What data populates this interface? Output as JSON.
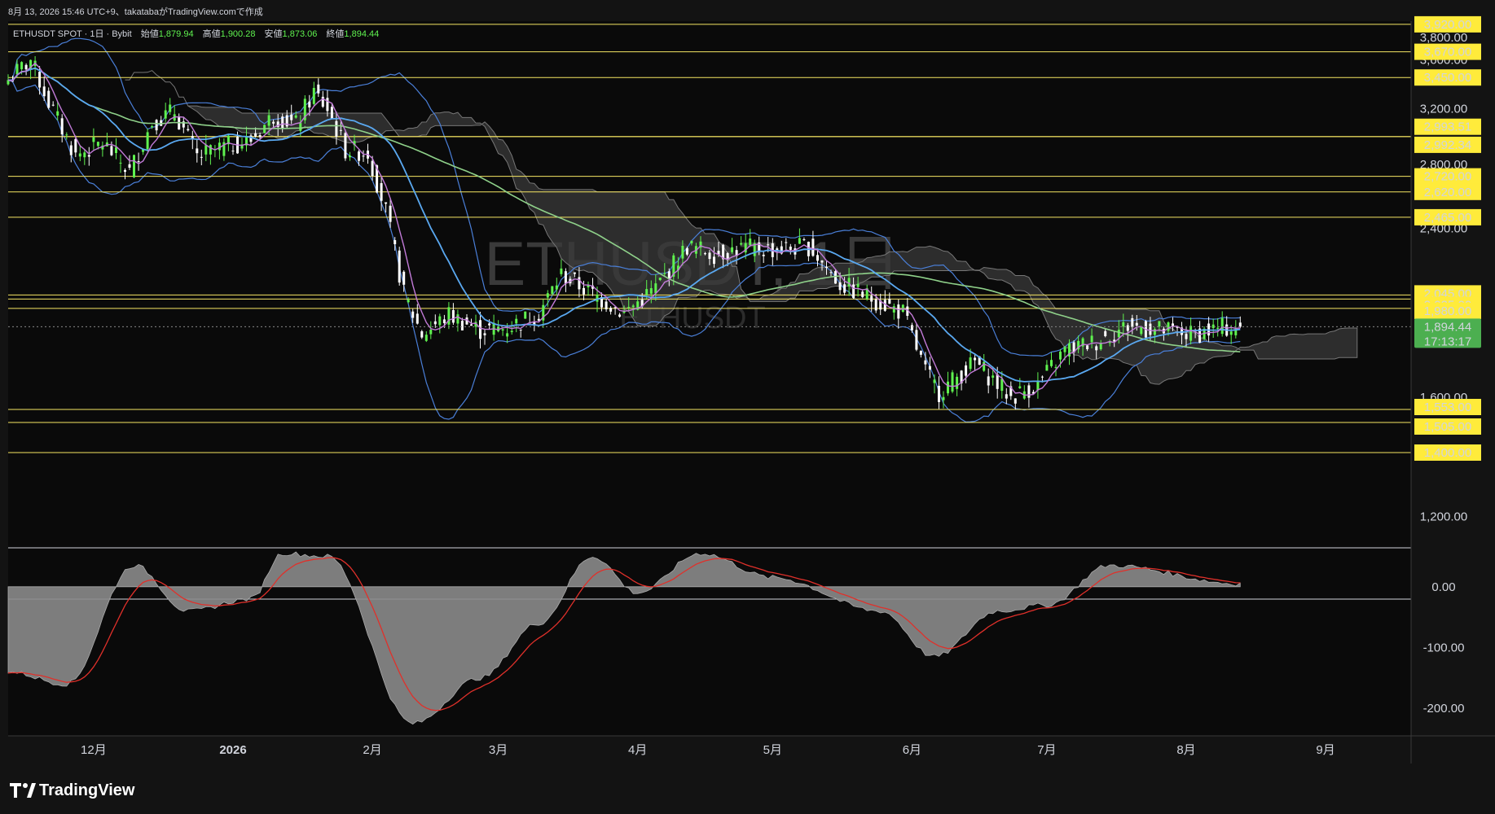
{
  "header": {
    "topline": "8月 13, 2026 15:46 UTC+9、takatabaがTradingView.comで作成",
    "symbol_line": "ETHUSDT SPOT · 1日 · Bybit",
    "ohlc": [
      {
        "label": "始値",
        "value": "1,879.94"
      },
      {
        "label": "高値",
        "value": "1,900.28"
      },
      {
        "label": "安値",
        "value": "1,873.06"
      },
      {
        "label": "終値",
        "value": "1,894.44"
      }
    ]
  },
  "watermark": {
    "main": "ETHUSDT, 1日",
    "sub": "ETHUSDT"
  },
  "footer": {
    "brand": "TradingView"
  },
  "colors": {
    "background": "#131313",
    "bull": "#5ff24f",
    "bear": "#ffffff",
    "level_line": "#f5e663",
    "label_bg": "#ffeb3b",
    "price_label_bg": "#4caf50",
    "ma_blue": "#5aa8f0",
    "ma_purple": "#c27bd8",
    "ma_green": "#8fd18a",
    "bb": "#4a7fd8",
    "cloud": "#3a3a3a",
    "macd_hist": "#8a8a8a",
    "macd_signal": "#e0302a"
  },
  "chart_data": [
    {
      "type": "candlestick",
      "title": "ETHUSDT SPOT · 1日 · Bybit",
      "x_axis": {
        "type": "time",
        "range": [
          "2025-11-12",
          "2026-09-20"
        ],
        "tick_labels": [
          "12月",
          "2026",
          "2月",
          "3月",
          "4月",
          "5月",
          "6月",
          "7月",
          "8月",
          "9月"
        ]
      },
      "y_axis": {
        "scale": "log",
        "range": [
          1120,
          3950
        ],
        "tick_labels": [
          "1,200.00",
          "1,600.00",
          "2,400.00",
          "2,800.00",
          "3,200.00",
          "3,450.00",
          "3,600.00",
          "3,800.00"
        ]
      },
      "last_price": {
        "value": 1894.44,
        "label": "1,894.44",
        "countdown": "17:13:17"
      },
      "price_levels": [
        {
          "value": 3920,
          "label": "3,920.00"
        },
        {
          "value": 3670,
          "label": "3,670.00"
        },
        {
          "value": 3450,
          "label": "3,450.00"
        },
        {
          "value": 2993.51,
          "label": "2,993.51"
        },
        {
          "value": 2992.34,
          "label": "2,992.34"
        },
        {
          "value": 2720,
          "label": "2,720.00"
        },
        {
          "value": 2620,
          "label": "2,620.00"
        },
        {
          "value": 2465,
          "label": "2,465.00"
        },
        {
          "value": 2045,
          "label": "2,045.00"
        },
        {
          "value": 2025,
          "label": "2,025.00"
        },
        {
          "value": 1980,
          "label": "1,980.00"
        },
        {
          "value": 1553,
          "label": "1,553.00"
        },
        {
          "value": 1505,
          "label": "1,505.00"
        },
        {
          "value": 1400,
          "label": "1,400.00"
        }
      ],
      "close_path": [
        {
          "date": "2025-11-12",
          "close": 3430
        },
        {
          "date": "2025-11-17",
          "close": 3600
        },
        {
          "date": "2025-11-21",
          "close": 3250
        },
        {
          "date": "2025-11-27",
          "close": 2860
        },
        {
          "date": "2025-12-03",
          "close": 2950
        },
        {
          "date": "2025-12-09",
          "close": 2750
        },
        {
          "date": "2025-12-14",
          "close": 3100
        },
        {
          "date": "2025-12-19",
          "close": 3180
        },
        {
          "date": "2025-12-24",
          "close": 2850
        },
        {
          "date": "2025-12-30",
          "close": 2920
        },
        {
          "date": "2026-01-05",
          "close": 2970
        },
        {
          "date": "2026-01-10",
          "close": 3150
        },
        {
          "date": "2026-01-15",
          "close": 3080
        },
        {
          "date": "2026-01-19",
          "close": 3330
        },
        {
          "date": "2026-01-22",
          "close": 3200
        },
        {
          "date": "2026-01-26",
          "close": 2900
        },
        {
          "date": "2026-01-31",
          "close": 2880
        },
        {
          "date": "2026-02-04",
          "close": 2500
        },
        {
          "date": "2026-02-08",
          "close": 2050
        },
        {
          "date": "2026-02-12",
          "close": 1860
        },
        {
          "date": "2026-02-18",
          "close": 1950
        },
        {
          "date": "2026-02-25",
          "close": 1880
        },
        {
          "date": "2026-03-03",
          "close": 1890
        },
        {
          "date": "2026-03-10",
          "close": 1960
        },
        {
          "date": "2026-03-15",
          "close": 2150
        },
        {
          "date": "2026-03-22",
          "close": 2050
        },
        {
          "date": "2026-03-29",
          "close": 1960
        },
        {
          "date": "2026-04-05",
          "close": 2080
        },
        {
          "date": "2026-04-12",
          "close": 2300
        },
        {
          "date": "2026-04-18",
          "close": 2260
        },
        {
          "date": "2026-04-25",
          "close": 2290
        },
        {
          "date": "2026-05-02",
          "close": 2280
        },
        {
          "date": "2026-05-09",
          "close": 2300
        },
        {
          "date": "2026-05-16",
          "close": 2100
        },
        {
          "date": "2026-05-23",
          "close": 2030
        },
        {
          "date": "2026-05-30",
          "close": 1960
        },
        {
          "date": "2026-06-04",
          "close": 1700
        },
        {
          "date": "2026-06-07",
          "close": 1620
        },
        {
          "date": "2026-06-15",
          "close": 1740
        },
        {
          "date": "2026-06-23",
          "close": 1600
        },
        {
          "date": "2026-06-29",
          "close": 1650
        },
        {
          "date": "2026-07-05",
          "close": 1790
        },
        {
          "date": "2026-07-12",
          "close": 1830
        },
        {
          "date": "2026-07-19",
          "close": 1900
        },
        {
          "date": "2026-07-26",
          "close": 1880
        },
        {
          "date": "2026-08-02",
          "close": 1860
        },
        {
          "date": "2026-08-09",
          "close": 1890
        },
        {
          "date": "2026-08-13",
          "close": 1894.44
        }
      ]
    },
    {
      "type": "area",
      "title": "",
      "y_axis": {
        "range": [
          -240,
          60
        ],
        "tick_labels": [
          "0.00",
          "-100.00",
          "-200.00"
        ]
      },
      "series": [
        {
          "name": "",
          "points": [
            {
              "date": "2025-11-12",
              "value": -140
            },
            {
              "date": "2025-11-25",
              "value": -160
            },
            {
              "date": "2025-12-10",
              "value": 35
            },
            {
              "date": "2025-12-22",
              "value": -40
            },
            {
              "date": "2026-01-05",
              "value": -20
            },
            {
              "date": "2026-01-12",
              "value": 55
            },
            {
              "date": "2026-01-22",
              "value": 50
            },
            {
              "date": "2026-02-10",
              "value": -225
            },
            {
              "date": "2026-02-25",
              "value": -150
            },
            {
              "date": "2026-03-10",
              "value": -60
            },
            {
              "date": "2026-03-22",
              "value": 50
            },
            {
              "date": "2026-04-01",
              "value": -10
            },
            {
              "date": "2026-04-15",
              "value": 55
            },
            {
              "date": "2026-05-01",
              "value": 15
            },
            {
              "date": "2026-05-25",
              "value": -40
            },
            {
              "date": "2026-06-06",
              "value": -115
            },
            {
              "date": "2026-06-20",
              "value": -40
            },
            {
              "date": "2026-07-01",
              "value": -30
            },
            {
              "date": "2026-07-15",
              "value": 35
            },
            {
              "date": "2026-08-13",
              "value": 5
            }
          ]
        }
      ]
    }
  ]
}
